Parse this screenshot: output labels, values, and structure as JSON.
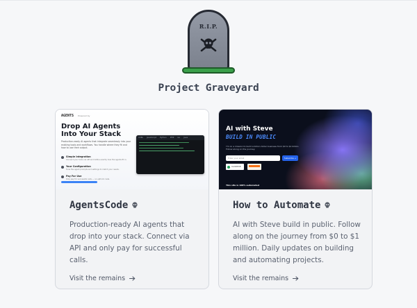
{
  "page": {
    "tombstone_text": "R.I.P.",
    "title": "Project Graveyard"
  },
  "colors": {
    "background": "#f6f7f9",
    "card_bg": "#f2f3f5",
    "card_border": "#d5d8de",
    "grass": "#3aa04a",
    "stone": "#8a909c"
  },
  "projects": [
    {
      "title": "AgentsCode",
      "icon": "skull-icon",
      "description": "Production-ready AI agents that drop into your stack. Connect via API and only pay for successful calls.",
      "link": "Visit the remains",
      "thumbnail": {
        "brand": "AGENTS",
        "powered": "Powered by",
        "headline": "Drop AI Agents Into Your Stack",
        "paragraph": "Production-ready AI agents that integrate seamlessly into your existing tools and workflows. You handle where they fit and how to use their output.",
        "features": [
          {
            "title": "Simple Integration",
            "sub": "Connect your tools via API and define exactly how the agents fit in."
          },
          {
            "title": "Your Configuration",
            "sub": "Tune the agent prompts and settings to match your needs."
          },
          {
            "title": "Pay For Use",
            "sub": "Only pay for successful calls — no upfront costs."
          }
        ],
        "code_tabs": [
          "cURL",
          "JavaScript",
          "Python",
          "PHP",
          "Go",
          "Java"
        ]
      }
    },
    {
      "title": "How to Automate",
      "icon": "skull-icon",
      "description": "AI with Steve build in public. Follow along on the journey from $0 to $1 million. Daily updates on building and automating projects.",
      "link": "Visit the remains",
      "thumbnail": {
        "headline": "AI with Steve",
        "subheadline": "BUILD IN PUBLIC",
        "paragraph": "I'm on a mission to build a billion dollar business from $0 to $1 billion. Follow along on the journey.",
        "input_placeholder": "Enter your email",
        "button": "Subscribe →",
        "badge": "CLOUDHUB",
        "footer": "This site is 100% automated"
      }
    }
  ]
}
